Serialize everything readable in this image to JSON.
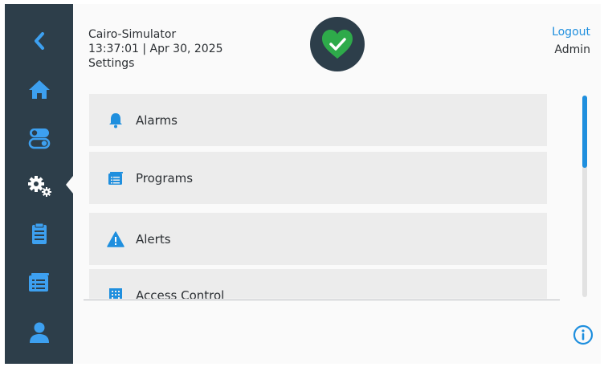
{
  "sidebar": {
    "items": [
      {
        "name": "back-icon",
        "active": false
      },
      {
        "name": "home-icon",
        "active": false
      },
      {
        "name": "toggle-icon",
        "active": false
      },
      {
        "name": "settings-gears-icon",
        "active": true
      },
      {
        "name": "clipboard-icon",
        "active": false
      },
      {
        "name": "programs-icon",
        "active": false
      },
      {
        "name": "user-icon",
        "active": false
      }
    ]
  },
  "header": {
    "device_name": "Cairo-Simulator",
    "datetime": "13:37:01 | Apr 30, 2025",
    "page_title": "Settings",
    "status": "heart-check-icon",
    "logout_label": "Logout",
    "user_role": "Admin"
  },
  "menu": {
    "items": [
      {
        "label": "Alarms",
        "icon": "bell-icon"
      },
      {
        "label": "Programs",
        "icon": "programs-icon"
      },
      {
        "label": "Alerts",
        "icon": "warning-icon"
      },
      {
        "label": "Access Control",
        "icon": "building-icon"
      }
    ]
  },
  "colors": {
    "sidebar": "#2d3e4a",
    "accent": "#1f8fde",
    "status_ok": "#2eaa4a",
    "menu_item_bg": "#ececec",
    "page_bg": "#fafafa"
  }
}
